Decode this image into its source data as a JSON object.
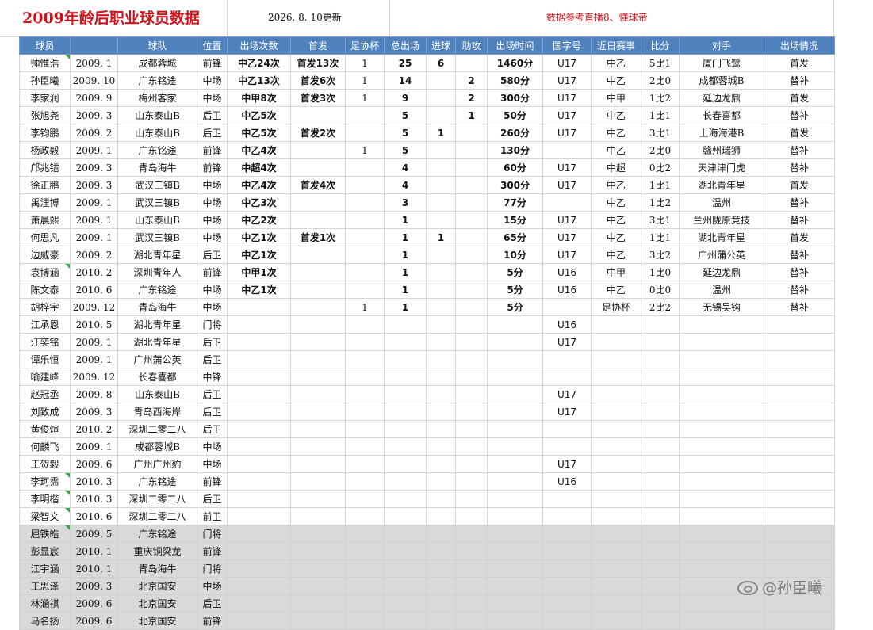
{
  "header": {
    "title": "2009年龄后职业球员数据",
    "date": "2026. 8. 10更新",
    "reference": "数据参考直播8、懂球帝"
  },
  "columns": [
    "球员",
    "球队",
    "位置",
    "出场次数",
    "首发",
    "足协杯",
    "总出场",
    "进球",
    "助攻",
    "出场时间",
    "国字号",
    "近日赛事",
    "比分",
    "对手",
    "出场情况"
  ],
  "players": [
    {
      "name": "帅惟浩",
      "flag": true,
      "birth": "2009. 1",
      "team": "成都蓉城",
      "pos": "前锋",
      "apps": "中乙24次",
      "starts": "首发13次",
      "cup": "1",
      "total": "25",
      "goals": "6",
      "assists": "",
      "minutes": "1460分",
      "intl": "U17",
      "recent": "中乙",
      "score": "5比1",
      "opponent": "厦门飞鹭",
      "status": "首发"
    },
    {
      "name": "孙臣曦",
      "flag": false,
      "birth": "2009. 10",
      "team": "广东铭途",
      "pos": "中场",
      "apps": "中乙13次",
      "starts": "首发6次",
      "cup": "1",
      "total": "14",
      "goals": "",
      "assists": "2",
      "minutes": "580分",
      "intl": "U17",
      "recent": "中乙",
      "score": "2比0",
      "opponent": "成都蓉城B",
      "status": "替补"
    },
    {
      "name": "李家润",
      "flag": false,
      "birth": "2009. 9",
      "team": "梅州客家",
      "pos": "中场",
      "apps": "中甲8次",
      "starts": "首发3次",
      "cup": "1",
      "total": "9",
      "goals": "",
      "assists": "2",
      "minutes": "300分",
      "intl": "U17",
      "recent": "中甲",
      "score": "1比2",
      "opponent": "延边龙鼎",
      "status": "首发"
    },
    {
      "name": "张旭尧",
      "flag": false,
      "birth": "2009. 3",
      "team": "山东泰山B",
      "pos": "后卫",
      "apps": "中乙5次",
      "starts": "",
      "cup": "",
      "total": "5",
      "goals": "",
      "assists": "1",
      "minutes": "50分",
      "intl": "U17",
      "recent": "中乙",
      "score": "1比1",
      "opponent": "长春喜都",
      "status": "替补"
    },
    {
      "name": "李钧鹏",
      "flag": false,
      "birth": "2009. 2",
      "team": "山东泰山B",
      "pos": "后卫",
      "apps": "中乙5次",
      "starts": "首发2次",
      "cup": "",
      "total": "5",
      "goals": "1",
      "assists": "",
      "minutes": "260分",
      "intl": "U17",
      "recent": "中乙",
      "score": "3比1",
      "opponent": "上海海港B",
      "status": "首发"
    },
    {
      "name": "杨政毅",
      "flag": false,
      "birth": "2009. 1",
      "team": "广东铭途",
      "pos": "前锋",
      "apps": "中乙4次",
      "starts": "",
      "cup": "1",
      "total": "5",
      "goals": "",
      "assists": "",
      "minutes": "130分",
      "intl": "",
      "recent": "中乙",
      "score": "2比0",
      "opponent": "赣州瑞狮",
      "status": "替补"
    },
    {
      "name": "邝兆镭",
      "flag": false,
      "birth": "2009. 3",
      "team": "青岛海牛",
      "pos": "前锋",
      "apps": "中超4次",
      "starts": "",
      "cup": "",
      "total": "4",
      "goals": "",
      "assists": "",
      "minutes": "60分",
      "intl": "U17",
      "recent": "中超",
      "score": "0比2",
      "opponent": "天津津门虎",
      "status": "替补"
    },
    {
      "name": "徐正鹏",
      "flag": false,
      "birth": "2009. 3",
      "team": "武汉三镇B",
      "pos": "中场",
      "apps": "中乙4次",
      "starts": "首发4次",
      "cup": "",
      "total": "4",
      "goals": "",
      "assists": "",
      "minutes": "300分",
      "intl": "U17",
      "recent": "中乙",
      "score": "1比1",
      "opponent": "湖北青年星",
      "status": "首发"
    },
    {
      "name": "禹浬博",
      "flag": false,
      "birth": "2009. 1",
      "team": "武汉三镇B",
      "pos": "中场",
      "apps": "中乙3次",
      "starts": "",
      "cup": "",
      "total": "3",
      "goals": "",
      "assists": "",
      "minutes": "77分",
      "intl": "",
      "recent": "中乙",
      "score": "1比2",
      "opponent": "温州",
      "status": "替补"
    },
    {
      "name": "萧晨熙",
      "flag": false,
      "birth": "2009. 1",
      "team": "山东泰山B",
      "pos": "中场",
      "apps": "中乙2次",
      "starts": "",
      "cup": "",
      "total": "1",
      "goals": "",
      "assists": "",
      "minutes": "15分",
      "intl": "U17",
      "recent": "中乙",
      "score": "3比1",
      "opponent": "兰州陇原竞技",
      "status": "替补"
    },
    {
      "name": "何思凡",
      "flag": false,
      "birth": "2009. 1",
      "team": "武汉三镇B",
      "pos": "中场",
      "apps": "中乙1次",
      "starts": "首发1次",
      "cup": "",
      "total": "1",
      "goals": "1",
      "assists": "",
      "minutes": "65分",
      "intl": "U17",
      "recent": "中乙",
      "score": "1比1",
      "opponent": "湖北青年星",
      "status": "首发"
    },
    {
      "name": "边威豪",
      "flag": false,
      "birth": "2009. 2",
      "team": "湖北青年星",
      "pos": "后卫",
      "apps": "中乙1次",
      "starts": "",
      "cup": "",
      "total": "1",
      "goals": "",
      "assists": "",
      "minutes": "10分",
      "intl": "U17",
      "recent": "中乙",
      "score": "3比2",
      "opponent": "广州蒲公英",
      "status": "替补"
    },
    {
      "name": "袁博涵",
      "flag": true,
      "birth": "2010. 2",
      "team": "深圳青年人",
      "pos": "前锋",
      "apps": "中甲1次",
      "starts": "",
      "cup": "",
      "total": "1",
      "goals": "",
      "assists": "",
      "minutes": "5分",
      "intl": "U16",
      "recent": "中甲",
      "score": "1比0",
      "opponent": "延边龙鼎",
      "status": "替补"
    },
    {
      "name": "陈文泰",
      "flag": false,
      "birth": "2010. 6",
      "team": "广东铭途",
      "pos": "中场",
      "apps": "中乙1次",
      "starts": "",
      "cup": "",
      "total": "1",
      "goals": "",
      "assists": "",
      "minutes": "5分",
      "intl": "U16",
      "recent": "中乙",
      "score": "0比0",
      "opponent": "温州",
      "status": "替补"
    },
    {
      "name": "胡梓宇",
      "flag": false,
      "birth": "2009. 12",
      "team": "青岛海牛",
      "pos": "中场",
      "apps": "",
      "starts": "",
      "cup": "1",
      "total": "1",
      "goals": "",
      "assists": "",
      "minutes": "5分",
      "intl": "",
      "recent": "足协杯",
      "score": "2比2",
      "opponent": "无锡吴钩",
      "status": "替补"
    },
    {
      "name": "江承恩",
      "flag": false,
      "birth": "2010. 5",
      "team": "湖北青年星",
      "pos": "门将",
      "apps": "",
      "starts": "",
      "cup": "",
      "total": "",
      "goals": "",
      "assists": "",
      "minutes": "",
      "intl": "U16",
      "recent": "",
      "score": "",
      "opponent": "",
      "status": ""
    },
    {
      "name": "汪奕铭",
      "flag": false,
      "birth": "2009. 1",
      "team": "湖北青年星",
      "pos": "后卫",
      "apps": "",
      "starts": "",
      "cup": "",
      "total": "",
      "goals": "",
      "assists": "",
      "minutes": "",
      "intl": "U17",
      "recent": "",
      "score": "",
      "opponent": "",
      "status": ""
    },
    {
      "name": "谭乐恒",
      "flag": false,
      "birth": "2009. 1",
      "team": "广州蒲公英",
      "pos": "后卫",
      "apps": "",
      "starts": "",
      "cup": "",
      "total": "",
      "goals": "",
      "assists": "",
      "minutes": "",
      "intl": "",
      "recent": "",
      "score": "",
      "opponent": "",
      "status": ""
    },
    {
      "name": "喻建峰",
      "flag": false,
      "birth": "2009. 12",
      "team": "长春喜都",
      "pos": "中锋",
      "apps": "",
      "starts": "",
      "cup": "",
      "total": "",
      "goals": "",
      "assists": "",
      "minutes": "",
      "intl": "",
      "recent": "",
      "score": "",
      "opponent": "",
      "status": ""
    },
    {
      "name": "赵冠丞",
      "flag": false,
      "birth": "2009. 8",
      "team": "山东泰山B",
      "pos": "后卫",
      "apps": "",
      "starts": "",
      "cup": "",
      "total": "",
      "goals": "",
      "assists": "",
      "minutes": "",
      "intl": "U17",
      "recent": "",
      "score": "",
      "opponent": "",
      "status": ""
    },
    {
      "name": "刘致成",
      "flag": false,
      "birth": "2009. 3",
      "team": "青岛西海岸",
      "pos": "后卫",
      "apps": "",
      "starts": "",
      "cup": "",
      "total": "",
      "goals": "",
      "assists": "",
      "minutes": "",
      "intl": "U17",
      "recent": "",
      "score": "",
      "opponent": "",
      "status": ""
    },
    {
      "name": "黄俊煊",
      "flag": false,
      "birth": "2010. 2",
      "team": "深圳二零二八",
      "pos": "后卫",
      "apps": "",
      "starts": "",
      "cup": "",
      "total": "",
      "goals": "",
      "assists": "",
      "minutes": "",
      "intl": "",
      "recent": "",
      "score": "",
      "opponent": "",
      "status": ""
    },
    {
      "name": "何麟飞",
      "flag": false,
      "birth": "2009. 1",
      "team": "成都蓉城B",
      "pos": "中场",
      "apps": "",
      "starts": "",
      "cup": "",
      "total": "",
      "goals": "",
      "assists": "",
      "minutes": "",
      "intl": "",
      "recent": "",
      "score": "",
      "opponent": "",
      "status": ""
    },
    {
      "name": "王贺毅",
      "flag": false,
      "birth": "2009. 6",
      "team": "广州广州豹",
      "pos": "中场",
      "apps": "",
      "starts": "",
      "cup": "",
      "total": "",
      "goals": "",
      "assists": "",
      "minutes": "",
      "intl": "U17",
      "recent": "",
      "score": "",
      "opponent": "",
      "status": ""
    },
    {
      "name": "李珂霈",
      "flag": true,
      "birth": "2010. 3",
      "team": "广东铭途",
      "pos": "前锋",
      "apps": "",
      "starts": "",
      "cup": "",
      "total": "",
      "goals": "",
      "assists": "",
      "minutes": "",
      "intl": "U16",
      "recent": "",
      "score": "",
      "opponent": "",
      "status": ""
    },
    {
      "name": "李明楷",
      "flag": true,
      "birth": "2010. 3",
      "team": "深圳二零二八",
      "pos": "后卫",
      "apps": "",
      "starts": "",
      "cup": "",
      "total": "",
      "goals": "",
      "assists": "",
      "minutes": "",
      "intl": "",
      "recent": "",
      "score": "",
      "opponent": "",
      "status": ""
    },
    {
      "name": "梁智文",
      "flag": true,
      "birth": "2010. 6",
      "team": "深圳二零二八",
      "pos": "前卫",
      "apps": "",
      "starts": "",
      "cup": "",
      "total": "",
      "goals": "",
      "assists": "",
      "minutes": "",
      "intl": "",
      "recent": "",
      "score": "",
      "opponent": "",
      "status": ""
    }
  ],
  "gray_players": [
    {
      "name": "屈铁皓",
      "flag": true,
      "birth": "2009. 5",
      "team": "广东铭途",
      "pos": "门将"
    },
    {
      "name": "彭显宸",
      "flag": false,
      "birth": "2010. 1",
      "team": "重庆铜梁龙",
      "pos": "前锋"
    },
    {
      "name": "江宇涵",
      "flag": false,
      "birth": "2010. 1",
      "team": "青岛海牛",
      "pos": "门将"
    },
    {
      "name": "王思泽",
      "flag": false,
      "birth": "2009. 3",
      "team": "北京国安",
      "pos": "中场"
    },
    {
      "name": "林涵祺",
      "flag": false,
      "birth": "2009. 6",
      "team": "北京国安",
      "pos": "后卫"
    },
    {
      "name": "马名扬",
      "flag": false,
      "birth": "2009. 6",
      "team": "北京国安",
      "pos": "前锋"
    }
  ],
  "watermark": "@孙臣曦",
  "colors": {
    "header_bg": "#4f81bd",
    "accent_red": "#d0121b",
    "gray_row": "#d9d9d9",
    "flag_green": "#3fa84a"
  }
}
